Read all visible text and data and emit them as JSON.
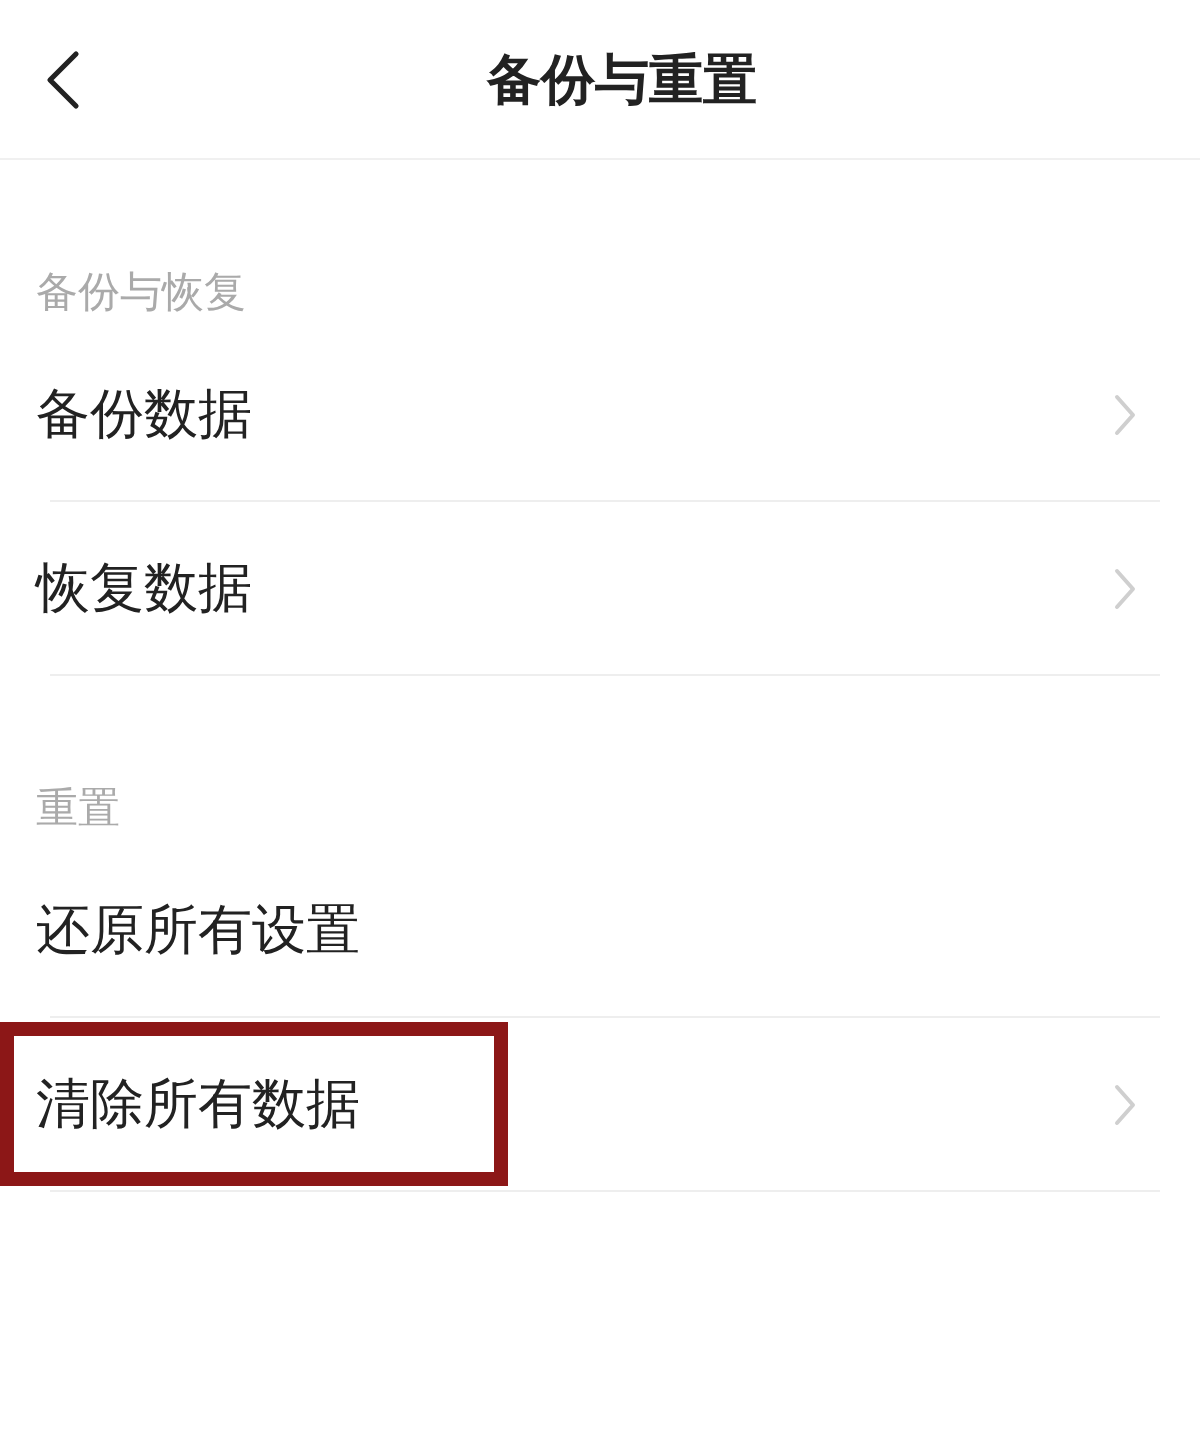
{
  "header": {
    "title": "备份与重置"
  },
  "sections": [
    {
      "title": "备份与恢复",
      "rows": [
        {
          "label": "备份数据",
          "chevron": true,
          "highlighted": false
        },
        {
          "label": "恢复数据",
          "chevron": true,
          "highlighted": false
        }
      ]
    },
    {
      "title": "重置",
      "rows": [
        {
          "label": "还原所有设置",
          "chevron": false,
          "highlighted": false
        },
        {
          "label": "清除所有数据",
          "chevron": true,
          "highlighted": true
        }
      ]
    }
  ]
}
